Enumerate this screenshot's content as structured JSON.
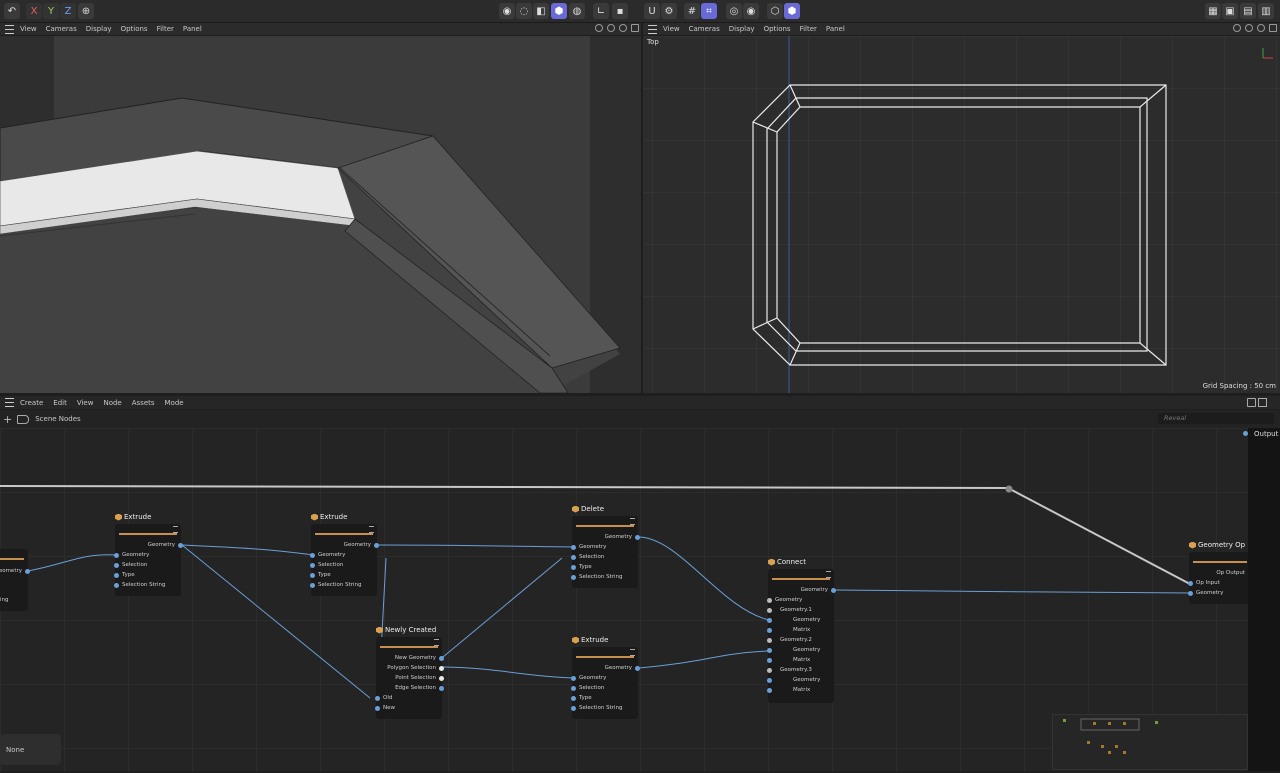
{
  "toolbar": {
    "axis_x": "X",
    "axis_y": "Y",
    "axis_z": "Z",
    "icons": [
      "undo-icon",
      "axis-x",
      "axis-y",
      "axis-z",
      "coordinate-icon",
      "live-select-icon",
      "move-icon",
      "model-mode-icon",
      "polygon-mode-icon",
      "texture-mode-icon",
      "workplane-icon",
      "snap-icon",
      "magnet-icon",
      "lock-icon",
      "grid-snap-icon",
      "quantize-icon",
      "render-icon",
      "render-settings-icon",
      "ir-icon",
      "picture-viewer-icon",
      "render-region-icon",
      "edit-render-icon"
    ]
  },
  "viewport_left": {
    "menu": [
      "View",
      "Cameras",
      "Display",
      "Options",
      "Filter",
      "Panel"
    ]
  },
  "viewport_right": {
    "menu": [
      "View",
      "Cameras",
      "Display",
      "Options",
      "Filter",
      "Panel"
    ],
    "camera_label": "Top",
    "grid_spacing": "Grid Spacing : 50 cm"
  },
  "node_editor": {
    "menu": [
      "Create",
      "Edit",
      "View",
      "Node",
      "Assets",
      "Mode"
    ],
    "breadcrumb": "Scene Nodes",
    "search_placeholder": "Reveal",
    "output_label": "Output",
    "status_none": "None",
    "nodes": {
      "partial_left": {
        "port_geometry": "Geometry",
        "port_partial": "ing"
      },
      "extrude1": {
        "title": "Extrude",
        "out": "Geometry",
        "inputs": [
          "Geometry",
          "Selection",
          "Type",
          "Selection String"
        ]
      },
      "extrude2": {
        "title": "Extrude",
        "out": "Geometry",
        "inputs": [
          "Geometry",
          "Selection",
          "Type",
          "Selection String"
        ]
      },
      "newly_created": {
        "title": "Newly Created",
        "outs": [
          "New Geometry",
          "Polygon Selection",
          "Point Selection",
          "Edge Selection"
        ],
        "inputs": [
          "Old",
          "New"
        ]
      },
      "delete": {
        "title": "Delete",
        "out": "Geometry",
        "inputs": [
          "Geometry",
          "Selection",
          "Type",
          "Selection String"
        ]
      },
      "extrude3": {
        "title": "Extrude",
        "out": "Geometry",
        "inputs": [
          "Geometry",
          "Selection",
          "Type",
          "Selection String"
        ]
      },
      "connect": {
        "title": "Connect",
        "out": "Geometry",
        "inputs": [
          "Geometry",
          "Geometry.1",
          "Geometry",
          "Matrix",
          "Geometry.2",
          "Geometry",
          "Matrix",
          "Geometry.3",
          "Geometry",
          "Matrix"
        ]
      },
      "geometry_op": {
        "title": "Geometry Op",
        "out": "Op Output",
        "inputs": [
          "Op Input",
          "Geometry"
        ]
      }
    }
  }
}
